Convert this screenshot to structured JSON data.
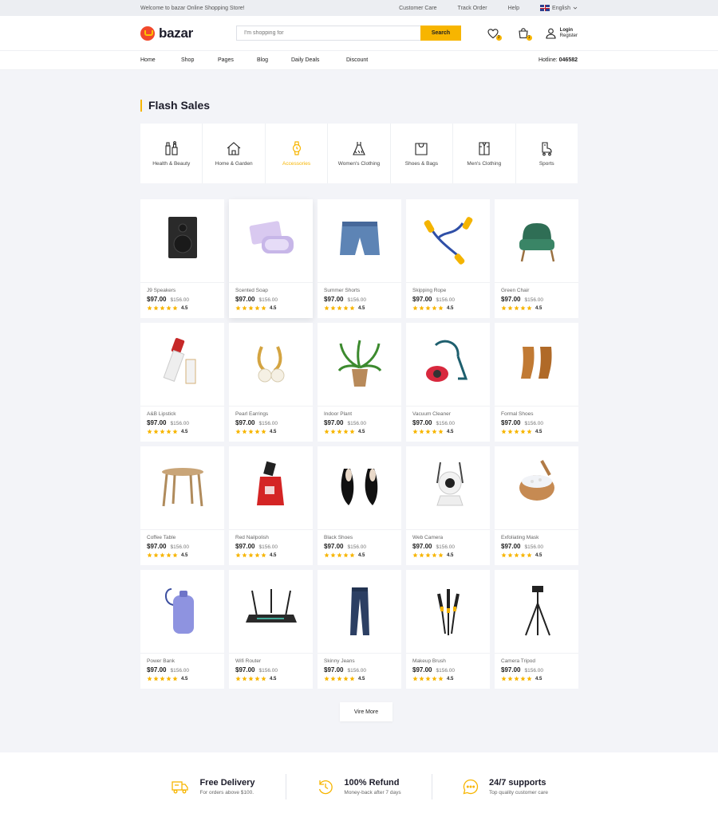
{
  "topbar": {
    "welcome": "Welcome to bazar Online Shopping Store!",
    "links": [
      "Customer Care",
      "Track Order",
      "Help"
    ],
    "language": "English"
  },
  "header": {
    "logo": "bazar",
    "search_placeholder": "I'm shopping for",
    "search_button": "Search",
    "wishlist_count": "3",
    "cart_count": "1",
    "login": "Login",
    "register": "Register"
  },
  "nav": {
    "items": [
      "Home",
      "Shop",
      "Pages",
      "Blog",
      "Daily Deals",
      "Discount"
    ],
    "hotline_label": "Hotline:",
    "hotline_number": "046582"
  },
  "flash": {
    "title": "Flash Sales",
    "categories": [
      {
        "label": "Health & Beauty",
        "icon": "health-beauty-icon"
      },
      {
        "label": "Home & Garden",
        "icon": "home-icon"
      },
      {
        "label": "Accessories",
        "icon": "watch-icon",
        "active": true
      },
      {
        "label": "Women's Clothing",
        "icon": "dress-icon"
      },
      {
        "label": "Shoes & Bags",
        "icon": "bag-icon"
      },
      {
        "label": "Men's Clothing",
        "icon": "shirt-icon"
      },
      {
        "label": "Sports",
        "icon": "skate-icon"
      }
    ],
    "products": [
      {
        "name": "J9 Speakers",
        "price": "$97.00",
        "old": "$156.00",
        "rating": "4.5"
      },
      {
        "name": "Scented Soap",
        "price": "$97.00",
        "old": "$156.00",
        "rating": "4.5"
      },
      {
        "name": "Summer Shorts",
        "price": "$97.00",
        "old": "$156.00",
        "rating": "4.5"
      },
      {
        "name": "Skipping Rope",
        "price": "$97.00",
        "old": "$156.00",
        "rating": "4.5"
      },
      {
        "name": "Green Chair",
        "price": "$97.00",
        "old": "$156.00",
        "rating": "4.5"
      },
      {
        "name": "A&B Lipstick",
        "price": "$97.00",
        "old": "$156.00",
        "rating": "4.5"
      },
      {
        "name": "Pearl Earrings",
        "price": "$97.00",
        "old": "$156.00",
        "rating": "4.5"
      },
      {
        "name": "Indoor Plant",
        "price": "$97.00",
        "old": "$156.00",
        "rating": "4.5"
      },
      {
        "name": "Vacuum Cleaner",
        "price": "$97.00",
        "old": "$156.00",
        "rating": "4.5"
      },
      {
        "name": "Formal Shoes",
        "price": "$97.00",
        "old": "$156.00",
        "rating": "4.5"
      },
      {
        "name": "Coffee Table",
        "price": "$97.00",
        "old": "$156.00",
        "rating": "4.5"
      },
      {
        "name": "Red Nailpolish",
        "price": "$97.00",
        "old": "$156.00",
        "rating": "4.5"
      },
      {
        "name": "Black Shoes",
        "price": "$97.00",
        "old": "$156.00",
        "rating": "4.5"
      },
      {
        "name": "Web Camera",
        "price": "$97.00",
        "old": "$156.00",
        "rating": "4.5"
      },
      {
        "name": "Exfoliating Mask",
        "price": "$97.00",
        "old": "$156.00",
        "rating": "4.5"
      },
      {
        "name": "Power Bank",
        "price": "$97.00",
        "old": "$156.00",
        "rating": "4.5"
      },
      {
        "name": "Wifi Router",
        "price": "$97.00",
        "old": "$156.00",
        "rating": "4.5"
      },
      {
        "name": "Skinny Jeans",
        "price": "$97.00",
        "old": "$156.00",
        "rating": "4.5"
      },
      {
        "name": "Makeup Brush",
        "price": "$97.00",
        "old": "$156.00",
        "rating": "4.5"
      },
      {
        "name": "Camera Tripod",
        "price": "$97.00",
        "old": "$156.00",
        "rating": "4.5"
      }
    ],
    "more_button": "Vire More"
  },
  "features": [
    {
      "title": "Free Delivery",
      "sub": "For orders above $100."
    },
    {
      "title": "100% Refund",
      "sub": "Money-back after 7 days"
    },
    {
      "title": "24/7 supports",
      "sub": "Top quality customer care"
    }
  ],
  "colors": {
    "accent": "#f7b500",
    "brand": "#f2492b",
    "bg": "#f3f4f8"
  }
}
